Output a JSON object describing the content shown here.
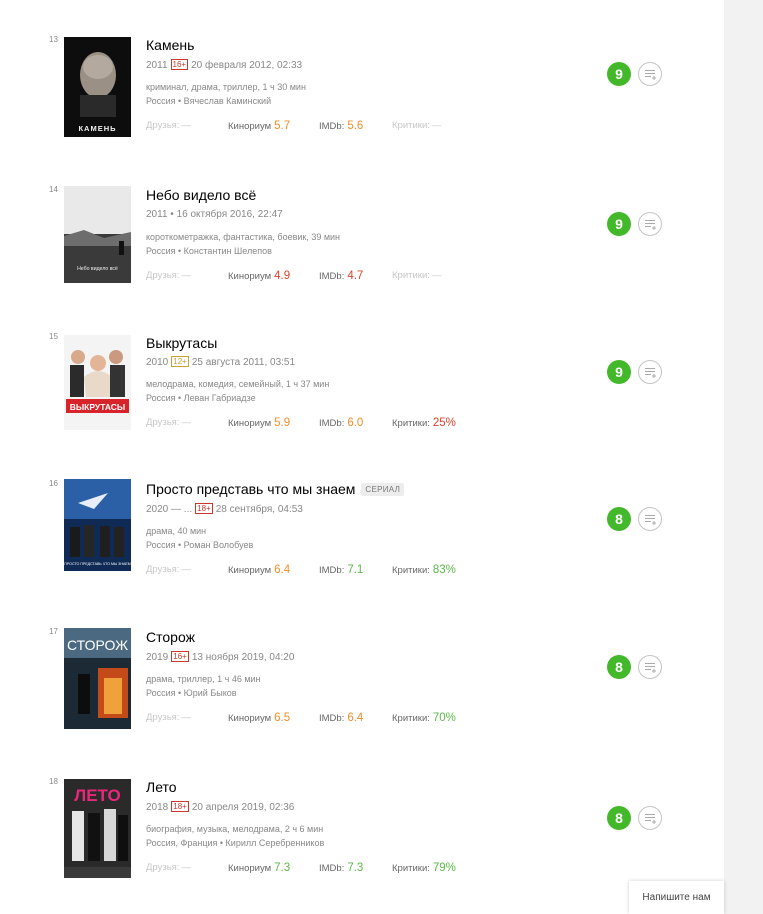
{
  "films": [
    {
      "position": "13",
      "title": "Камень",
      "serial_badge": "",
      "year": "2011",
      "age": "16+",
      "watched": "20 февраля 2012, 02:33",
      "genre_line": "криминал, драма, триллер, 1 ч 30 мин",
      "country_line": "Россия • Вячеслав Каминский",
      "poster_caption": "КАМЕНЬ",
      "friends_label": "Друзья:",
      "friends_value": "—",
      "kinorium_label": "Кинориум",
      "kinorium_value": "5.7",
      "imdb_label": "IMDb:",
      "imdb_value": "5.6",
      "critics_label": "Критики:",
      "critics_value": "—",
      "user_rating": "9"
    },
    {
      "position": "14",
      "title": "Небо видело всё",
      "serial_badge": "",
      "year": "2011",
      "age": "",
      "watched": "• 16 октября 2016, 22:47",
      "genre_line": "короткометражка, фантастика, боевик, 39 мин",
      "country_line": "Россия • Константин Шелепов",
      "poster_caption": "Небо видело всё",
      "friends_label": "Друзья:",
      "friends_value": "—",
      "kinorium_label": "Кинориум",
      "kinorium_value": "4.9",
      "imdb_label": "IMDb:",
      "imdb_value": "4.7",
      "critics_label": "Критики:",
      "critics_value": "—",
      "user_rating": "9"
    },
    {
      "position": "15",
      "title": "Выкрутасы",
      "serial_badge": "",
      "year": "2010",
      "age": "12+",
      "watched": "25 августа 2011, 03:51",
      "genre_line": "мелодрама, комедия, семейный, 1 ч 37 мин",
      "country_line": "Россия • Леван Габриадзе",
      "poster_caption": "ВЫКРУТАСЫ",
      "friends_label": "Друзья:",
      "friends_value": "—",
      "kinorium_label": "Кинориум",
      "kinorium_value": "5.9",
      "imdb_label": "IMDb:",
      "imdb_value": "6.0",
      "critics_label": "Критики:",
      "critics_value": "25%",
      "user_rating": "9"
    },
    {
      "position": "16",
      "title": "Просто представь что мы знаем",
      "serial_badge": "СЕРИАЛ",
      "year": "2020 — ...",
      "age": "18+",
      "watched": "28 сентября, 04:53",
      "genre_line": "драма, 40 мин",
      "country_line": "Россия • Роман Волобуев",
      "poster_caption": "ПРОСТО ПРЕДСТАВЬ ЧТО МЫ ЗНАЕМ",
      "friends_label": "Друзья:",
      "friends_value": "—",
      "kinorium_label": "Кинориум",
      "kinorium_value": "6.4",
      "imdb_label": "IMDb:",
      "imdb_value": "7.1",
      "critics_label": "Критики:",
      "critics_value": "83%",
      "user_rating": "8"
    },
    {
      "position": "17",
      "title": "Сторож",
      "serial_badge": "",
      "year": "2019",
      "age": "16+",
      "watched": "13 ноября 2019, 04:20",
      "genre_line": "драма, триллер, 1 ч 46 мин",
      "country_line": "Россия • Юрий Быков",
      "poster_caption": "СТОРОЖ",
      "friends_label": "Друзья:",
      "friends_value": "—",
      "kinorium_label": "Кинориум",
      "kinorium_value": "6.5",
      "imdb_label": "IMDb:",
      "imdb_value": "6.4",
      "critics_label": "Критики:",
      "critics_value": "70%",
      "user_rating": "8"
    },
    {
      "position": "18",
      "title": "Лето",
      "serial_badge": "",
      "year": "2018",
      "age": "18+",
      "watched": "20 апреля 2019, 02:36",
      "genre_line": "биография, музыка, мелодрама, 2 ч 6 мин",
      "country_line": "Россия, Франция • Кирилл Серебренников",
      "poster_caption": "ЛЕТО",
      "friends_label": "Друзья:",
      "friends_value": "—",
      "kinorium_label": "Кинориум",
      "kinorium_value": "7.3",
      "imdb_label": "IMDb:",
      "imdb_value": "7.3",
      "critics_label": "Критики:",
      "critics_value": "79%",
      "user_rating": "8"
    }
  ],
  "colors": {
    "rating_green": "#44b82b",
    "value_orange": "#ef8f2a",
    "value_red": "#d9452d",
    "value_green": "#5db84a",
    "age_badge_red": "#c83a2c"
  },
  "icons": {
    "add_to_list": "list-add-icon"
  },
  "feedback_button": {
    "label": "Напишите нам"
  }
}
